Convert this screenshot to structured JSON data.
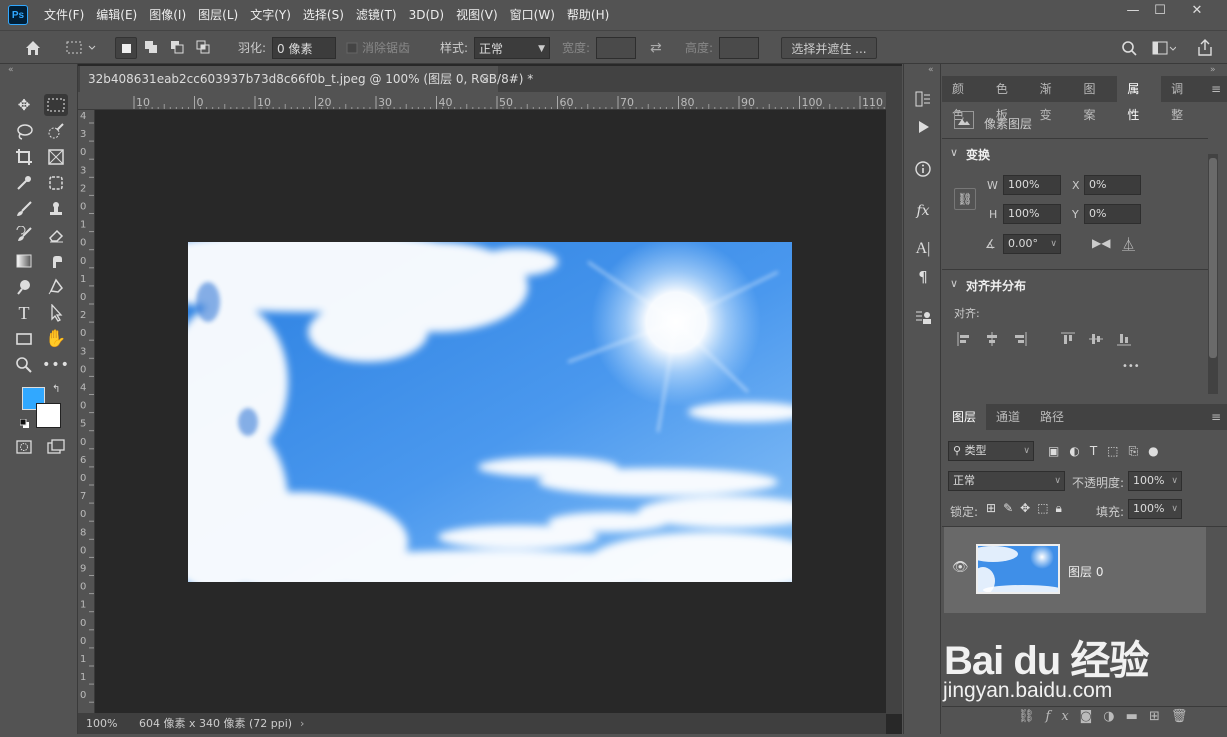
{
  "app": {
    "logo": "Ps"
  },
  "menu": [
    "文件(F)",
    "编辑(E)",
    "图像(I)",
    "图层(L)",
    "文字(Y)",
    "选择(S)",
    "滤镜(T)",
    "3D(D)",
    "视图(V)",
    "窗口(W)",
    "帮助(H)"
  ],
  "window_controls": {
    "minimize": "—",
    "maximize": "☐",
    "close": "✕"
  },
  "options": {
    "feather_label": "羽化:",
    "feather_value": "0 像素",
    "antialias_label": "消除锯齿",
    "style_label": "样式:",
    "style_value": "正常",
    "width_label": "宽度:",
    "height_label": "高度:",
    "select_mask_button": "选择并遮住 ..."
  },
  "document": {
    "tab_title": "32b408631eab2cc603937b73d8c66f0b_t.jpeg @ 100% (图层 0, RGB/8#) *",
    "zoom": "100%",
    "info": "604 像素 x 340 像素 (72 ppi)"
  },
  "rulers": {
    "h_labels": [
      "10",
      "0",
      "10",
      "20",
      "30",
      "40",
      "50",
      "60",
      "70",
      "80",
      "90",
      "100",
      "110"
    ],
    "v_labels": [
      "4",
      "3",
      "0",
      "3",
      "2",
      "0",
      "1",
      "0",
      "0",
      "1",
      "0",
      "2",
      "0",
      "3",
      "0",
      "4",
      "0",
      "5",
      "0",
      "6",
      "0",
      "7",
      "0",
      "8",
      "0",
      "9",
      "0",
      "1",
      "0",
      "0",
      "1",
      "1",
      "0"
    ]
  },
  "properties_panel": {
    "tabs": [
      "颜色",
      "色板",
      "渐变",
      "图案",
      "属性",
      "调整"
    ],
    "active_tab": "属性",
    "layer_type": "像素图层",
    "transform_title": "变换",
    "w_label": "W",
    "w_value": "100%",
    "h_label": "H",
    "h_value": "100%",
    "x_label": "X",
    "x_value": "0%",
    "y_label": "Y",
    "y_value": "0%",
    "angle_value": "0.00°",
    "align_title": "对齐并分布",
    "align_label": "对齐:",
    "more": "•••"
  },
  "layers_panel": {
    "tabs": [
      "图层",
      "通道",
      "路径"
    ],
    "filter_label": "类型",
    "blend_mode": "正常",
    "opacity_label": "不透明度:",
    "opacity_value": "100%",
    "lock_label": "锁定:",
    "fill_label": "填充:",
    "fill_value": "100%",
    "layers": [
      {
        "name": "图层 0"
      }
    ],
    "footer_icons": [
      "link-icon",
      "fx-icon",
      "mask-icon",
      "adjustment-icon",
      "group-icon",
      "new-layer-icon",
      "trash-icon"
    ]
  },
  "watermark": {
    "brand": "Bai du 经验",
    "url": "jingyan.baidu.com"
  },
  "colors": {
    "foreground": "#31a8ff",
    "background": "#ffffff",
    "ui_bg": "#535353",
    "canvas_bg": "#282828"
  }
}
